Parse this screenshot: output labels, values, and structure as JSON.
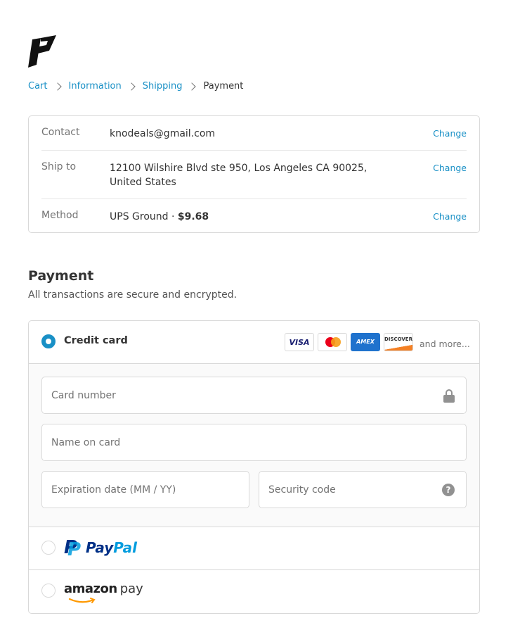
{
  "breadcrumb": {
    "items": [
      "Cart",
      "Information",
      "Shipping"
    ],
    "current": "Payment"
  },
  "review": {
    "contact": {
      "label": "Contact",
      "value": "knodeals@gmail.com",
      "action": "Change"
    },
    "ship_to": {
      "label": "Ship to",
      "value": "12100 Wilshire Blvd ste 950, Los Angeles CA 90025, United States",
      "action": "Change"
    },
    "method": {
      "label": "Method",
      "value": "UPS Ground · ",
      "price": "$9.68",
      "action": "Change"
    }
  },
  "payment": {
    "title": "Payment",
    "subtitle": "All transactions are secure and encrypted.",
    "credit_card": {
      "label": "Credit card",
      "selected": true,
      "brands": [
        "VISA",
        "AMEX",
        "DISCOVER"
      ],
      "brand_icons": [
        "visa-logo",
        "mastercard-logo",
        "amex-logo",
        "discover-logo"
      ],
      "more": "and more...",
      "card_number_placeholder": "Card number",
      "name_placeholder": "Name on card",
      "expiry_placeholder": "Expiration date (MM / YY)",
      "cvv_placeholder": "Security code",
      "help_glyph": "?"
    },
    "paypal": {
      "pay": "Pay",
      "pal": "Pal",
      "p_glyph": "P",
      "selected": false
    },
    "amazon_pay": {
      "amazon": "amazon",
      "pay": "pay",
      "selected": false
    }
  },
  "colors": {
    "accent": "#1990c6",
    "border": "#d9d9d9",
    "muted": "#737373",
    "paypal_dark": "#003087",
    "paypal_light": "#009cde",
    "amazon_orange": "#ff9900"
  }
}
